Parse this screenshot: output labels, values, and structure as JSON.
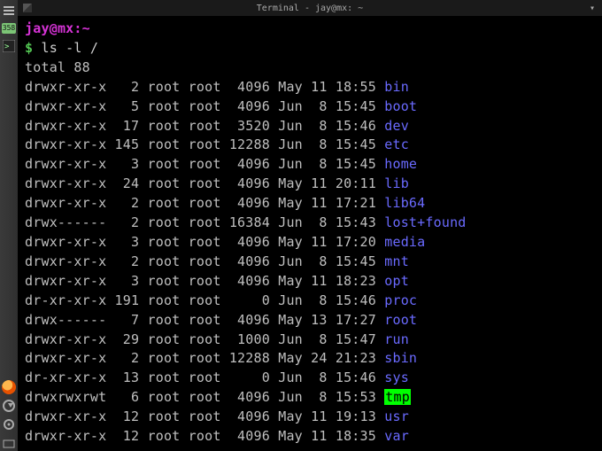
{
  "titlebar": {
    "text": "Terminal - jay@mx: ~"
  },
  "panel": {
    "badge": "358"
  },
  "prompt": {
    "user": "jay",
    "at": "@",
    "host": "mx",
    "colon": ":",
    "path": "~",
    "dollar": "$",
    "command": "ls -l /"
  },
  "total_line": "total 88",
  "rows": [
    {
      "perm": "drwxr-xr-x",
      "links": "2",
      "own": "root",
      "grp": "root",
      "size": "4096",
      "date": "May 11 18:55",
      "name": "bin",
      "cls": "dir"
    },
    {
      "perm": "drwxr-xr-x",
      "links": "5",
      "own": "root",
      "grp": "root",
      "size": "4096",
      "date": "Jun  8 15:45",
      "name": "boot",
      "cls": "dir"
    },
    {
      "perm": "drwxr-xr-x",
      "links": "17",
      "own": "root",
      "grp": "root",
      "size": "3520",
      "date": "Jun  8 15:46",
      "name": "dev",
      "cls": "dir"
    },
    {
      "perm": "drwxr-xr-x",
      "links": "145",
      "own": "root",
      "grp": "root",
      "size": "12288",
      "date": "Jun  8 15:45",
      "name": "etc",
      "cls": "dir"
    },
    {
      "perm": "drwxr-xr-x",
      "links": "3",
      "own": "root",
      "grp": "root",
      "size": "4096",
      "date": "Jun  8 15:45",
      "name": "home",
      "cls": "dir"
    },
    {
      "perm": "drwxr-xr-x",
      "links": "24",
      "own": "root",
      "grp": "root",
      "size": "4096",
      "date": "May 11 20:11",
      "name": "lib",
      "cls": "dir"
    },
    {
      "perm": "drwxr-xr-x",
      "links": "2",
      "own": "root",
      "grp": "root",
      "size": "4096",
      "date": "May 11 17:21",
      "name": "lib64",
      "cls": "dir"
    },
    {
      "perm": "drwx------",
      "links": "2",
      "own": "root",
      "grp": "root",
      "size": "16384",
      "date": "Jun  8 15:43",
      "name": "lost+found",
      "cls": "dir"
    },
    {
      "perm": "drwxr-xr-x",
      "links": "3",
      "own": "root",
      "grp": "root",
      "size": "4096",
      "date": "May 11 17:20",
      "name": "media",
      "cls": "dir"
    },
    {
      "perm": "drwxr-xr-x",
      "links": "2",
      "own": "root",
      "grp": "root",
      "size": "4096",
      "date": "Jun  8 15:45",
      "name": "mnt",
      "cls": "dir"
    },
    {
      "perm": "drwxr-xr-x",
      "links": "3",
      "own": "root",
      "grp": "root",
      "size": "4096",
      "date": "May 11 18:23",
      "name": "opt",
      "cls": "dir"
    },
    {
      "perm": "dr-xr-xr-x",
      "links": "191",
      "own": "root",
      "grp": "root",
      "size": "0",
      "date": "Jun  8 15:46",
      "name": "proc",
      "cls": "dir"
    },
    {
      "perm": "drwx------",
      "links": "7",
      "own": "root",
      "grp": "root",
      "size": "4096",
      "date": "May 13 17:27",
      "name": "root",
      "cls": "dir"
    },
    {
      "perm": "drwxr-xr-x",
      "links": "29",
      "own": "root",
      "grp": "root",
      "size": "1000",
      "date": "Jun  8 15:47",
      "name": "run",
      "cls": "dir"
    },
    {
      "perm": "drwxr-xr-x",
      "links": "2",
      "own": "root",
      "grp": "root",
      "size": "12288",
      "date": "May 24 21:23",
      "name": "sbin",
      "cls": "dir"
    },
    {
      "perm": "dr-xr-xr-x",
      "links": "13",
      "own": "root",
      "grp": "root",
      "size": "0",
      "date": "Jun  8 15:46",
      "name": "sys",
      "cls": "dir"
    },
    {
      "perm": "drwxrwxrwt",
      "links": "6",
      "own": "root",
      "grp": "root",
      "size": "4096",
      "date": "Jun  8 15:53",
      "name": "tmp",
      "cls": "sticky"
    },
    {
      "perm": "drwxr-xr-x",
      "links": "12",
      "own": "root",
      "grp": "root",
      "size": "4096",
      "date": "May 11 19:13",
      "name": "usr",
      "cls": "dir"
    },
    {
      "perm": "drwxr-xr-x",
      "links": "12",
      "own": "root",
      "grp": "root",
      "size": "4096",
      "date": "May 11 18:35",
      "name": "var",
      "cls": "dir"
    }
  ]
}
